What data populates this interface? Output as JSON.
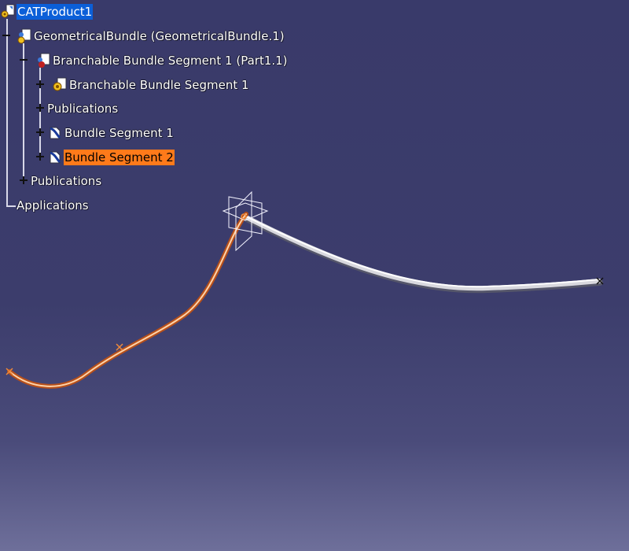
{
  "window": {
    "background_top": "#393a6a",
    "background_bottom": "#6e6f9a"
  },
  "tree": {
    "root": {
      "label": "CATProduct1",
      "icon": "product-icon"
    },
    "bundle": {
      "label": "GeometricalBundle (GeometricalBundle.1)",
      "icon": "bundle-icon",
      "expander": "minus"
    },
    "part": {
      "label": "Branchable Bundle Segment 1 (Part1.1)",
      "icon": "part-icon",
      "expander": "minus"
    },
    "part_body": {
      "label": "Branchable Bundle Segment 1",
      "icon": "part-body-icon",
      "expander": "plus"
    },
    "part_publications": {
      "label": "Publications",
      "expander": "plus"
    },
    "segment1": {
      "label": "Bundle Segment 1",
      "icon": "bundle-segment-icon",
      "expander": "plus"
    },
    "segment2": {
      "label": "Bundle Segment 2",
      "icon": "bundle-segment-icon",
      "expander": "plus",
      "highlight": "#ff7a1a"
    },
    "bundle_publications": {
      "label": "Publications",
      "expander": "plus"
    },
    "applications": {
      "label": "Applications"
    }
  },
  "scene": {
    "segment_1_color": "#e0e0e6",
    "segment_2_color": "#e07a2a",
    "compass": "axis-compass-icon"
  }
}
